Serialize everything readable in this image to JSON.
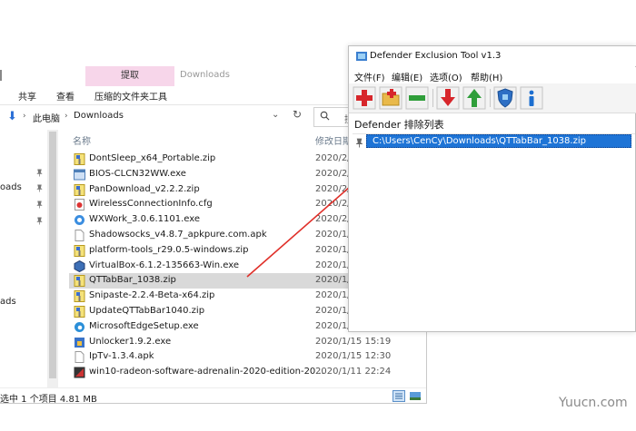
{
  "explorer": {
    "title": "Downloads",
    "context_tab": "提取",
    "ribbon_tabs": [
      "共享",
      "查看",
      "压缩的文件夹工具"
    ],
    "breadcrumb": [
      "此电脑",
      "Downloads"
    ],
    "search_placeholder": "搜",
    "nav_items": [
      "oads",
      "ads"
    ],
    "columns": {
      "name": "名称",
      "date": "修改日期"
    },
    "files": [
      {
        "name": "DontSleep_x64_Portable.zip",
        "date": "2020/2/",
        "icon": "zip-icon"
      },
      {
        "name": "BIOS-CLCN32WW.exe",
        "date": "2020/2/",
        "icon": "exe-icon"
      },
      {
        "name": "PanDownload_v2.2.2.zip",
        "date": "2020/2/",
        "icon": "zip-icon"
      },
      {
        "name": "WirelessConnectionInfo.cfg",
        "date": "2020/2/",
        "icon": "cfg-icon"
      },
      {
        "name": "WXWork_3.0.6.1101.exe",
        "date": "2020/2/",
        "icon": "wxwork-icon"
      },
      {
        "name": "Shadowsocks_v4.8.7_apkpure.com.apk",
        "date": "2020/1/",
        "icon": "file-icon"
      },
      {
        "name": "platform-tools_r29.0.5-windows.zip",
        "date": "2020/1/",
        "icon": "zip-icon"
      },
      {
        "name": "VirtualBox-6.1.2-135663-Win.exe",
        "date": "2020/1/",
        "icon": "virtualbox-icon"
      },
      {
        "name": "QTTabBar_1038.zip",
        "date": "2020/1/",
        "icon": "zip-icon",
        "selected": true
      },
      {
        "name": "Snipaste-2.2.4-Beta-x64.zip",
        "date": "2020/1/",
        "icon": "zip-icon"
      },
      {
        "name": "UpdateQTTabBar1040.zip",
        "date": "2020/1/",
        "icon": "zip-icon"
      },
      {
        "name": "MicrosoftEdgeSetup.exe",
        "date": "2020/1/",
        "icon": "edge-icon"
      },
      {
        "name": "Unlocker1.9.2.exe",
        "date": "2020/1/15 15:19",
        "icon": "unlocker-icon"
      },
      {
        "name": "IpTv-1.3.4.apk",
        "date": "2020/1/15 12:30",
        "icon": "file-icon"
      },
      {
        "name": "win10-radeon-software-adrenalin-2020-edition-20...",
        "date": "2020/1/11 22:24",
        "icon": "installer-icon"
      }
    ],
    "status": "选中 1 个项目  4.81 MB"
  },
  "tool": {
    "title": "Defender Exclusion Tool v1.3",
    "menu": [
      "文件(F)",
      "编辑(E)",
      "选项(O)",
      "帮助(H)"
    ],
    "toolbar_icons": [
      "add-icon",
      "add-folder-icon",
      "remove-icon",
      "import-icon",
      "export-icon",
      "defender-icon",
      "info-icon"
    ],
    "list_label": "Defender 排除列表",
    "exclusions": [
      "C:\\Users\\CenCy\\Downloads\\QTTabBar_1038.zip"
    ]
  },
  "watermark": "Yuucn.com",
  "colors": {
    "selection_blue": "#1e74d6",
    "ribbon_context": "#f7d6ea",
    "arrow": "#e0302a"
  }
}
